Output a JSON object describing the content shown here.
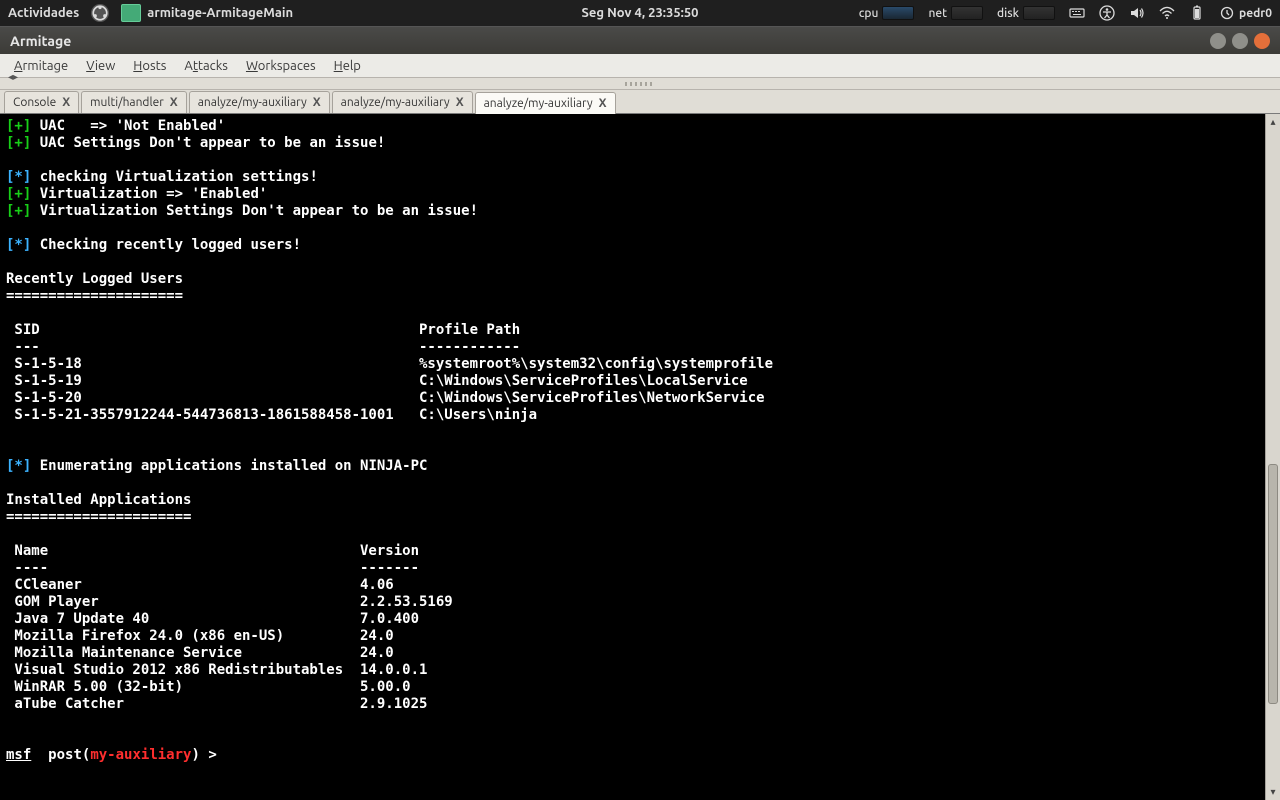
{
  "topbar": {
    "activities_label": "Actividades",
    "task_title": "armitage-ArmitageMain",
    "clock": "Seg Nov  4, 23:35:50",
    "cpu_label": "cpu",
    "net_label": "net",
    "disk_label": "disk",
    "username": "pedr0"
  },
  "window": {
    "title": "Armitage"
  },
  "menus": [
    "Armitage",
    "View",
    "Hosts",
    "Attacks",
    "Workspaces",
    "Help"
  ],
  "tabs": [
    {
      "label": "Console",
      "active": false
    },
    {
      "label": "multi/handler",
      "active": false
    },
    {
      "label": "analyze/my-auxiliary",
      "active": false
    },
    {
      "label": "analyze/my-auxiliary",
      "active": false
    },
    {
      "label": "analyze/my-auxiliary",
      "active": true
    }
  ],
  "terminal": {
    "lines": [
      {
        "prefix": "plus",
        "prefixText": "[+]",
        "text": " UAC   => 'Not Enabled'"
      },
      {
        "prefix": "plus",
        "prefixText": "[+]",
        "text": " UAC Settings Don't appear to be an issue!"
      },
      {
        "prefix": "blank",
        "text": ""
      },
      {
        "prefix": "star",
        "prefixText": "[*]",
        "text": " checking Virtualization settings!"
      },
      {
        "prefix": "plus",
        "prefixText": "[+]",
        "text": " Virtualization => 'Enabled'"
      },
      {
        "prefix": "plus",
        "prefixText": "[+]",
        "text": " Virtualization Settings Don't appear to be an issue!"
      },
      {
        "prefix": "blank",
        "text": ""
      },
      {
        "prefix": "star",
        "prefixText": "[*]",
        "text": " Checking recently logged users!"
      },
      {
        "prefix": "blank",
        "text": ""
      },
      {
        "prefix": "head",
        "text": "Recently Logged Users"
      },
      {
        "prefix": "head",
        "text": "====================="
      },
      {
        "prefix": "blank",
        "text": ""
      },
      {
        "prefix": "head",
        "text": " SID                                             Profile Path"
      },
      {
        "prefix": "head",
        "text": " ---                                             ------------"
      },
      {
        "prefix": "row",
        "text": " S-1-5-18                                        %systemroot%\\system32\\config\\systemprofile"
      },
      {
        "prefix": "row",
        "text": " S-1-5-19                                        C:\\Windows\\ServiceProfiles\\LocalService"
      },
      {
        "prefix": "row",
        "text": " S-1-5-20                                        C:\\Windows\\ServiceProfiles\\NetworkService"
      },
      {
        "prefix": "row",
        "text": " S-1-5-21-3557912244-544736813-1861588458-1001   C:\\Users\\ninja"
      },
      {
        "prefix": "blank",
        "text": ""
      },
      {
        "prefix": "blank",
        "text": ""
      },
      {
        "prefix": "star",
        "prefixText": "[*]",
        "text": " Enumerating applications installed on NINJA-PC"
      },
      {
        "prefix": "blank",
        "text": ""
      },
      {
        "prefix": "head",
        "text": "Installed Applications"
      },
      {
        "prefix": "head",
        "text": "======================"
      },
      {
        "prefix": "blank",
        "text": ""
      },
      {
        "prefix": "head",
        "text": " Name                                     Version"
      },
      {
        "prefix": "head",
        "text": " ----                                     -------"
      },
      {
        "prefix": "row",
        "text": " CCleaner                                 4.06"
      },
      {
        "prefix": "row",
        "text": " GOM Player                               2.2.53.5169"
      },
      {
        "prefix": "row",
        "text": " Java 7 Update 40                         7.0.400"
      },
      {
        "prefix": "row",
        "text": " Mozilla Firefox 24.0 (x86 en-US)         24.0"
      },
      {
        "prefix": "row",
        "text": " Mozilla Maintenance Service              24.0"
      },
      {
        "prefix": "row",
        "text": " Visual Studio 2012 x86 Redistributables  14.0.0.1"
      },
      {
        "prefix": "row",
        "text": " WinRAR 5.00 (32-bit)                     5.00.0"
      },
      {
        "prefix": "row",
        "text": " aTube Catcher                            2.9.1025"
      },
      {
        "prefix": "blank",
        "text": ""
      },
      {
        "prefix": "blank",
        "text": ""
      }
    ],
    "prompt": {
      "msf": "msf",
      "post": "  post(",
      "module": "my-auxiliary",
      "tail": ") > "
    }
  }
}
